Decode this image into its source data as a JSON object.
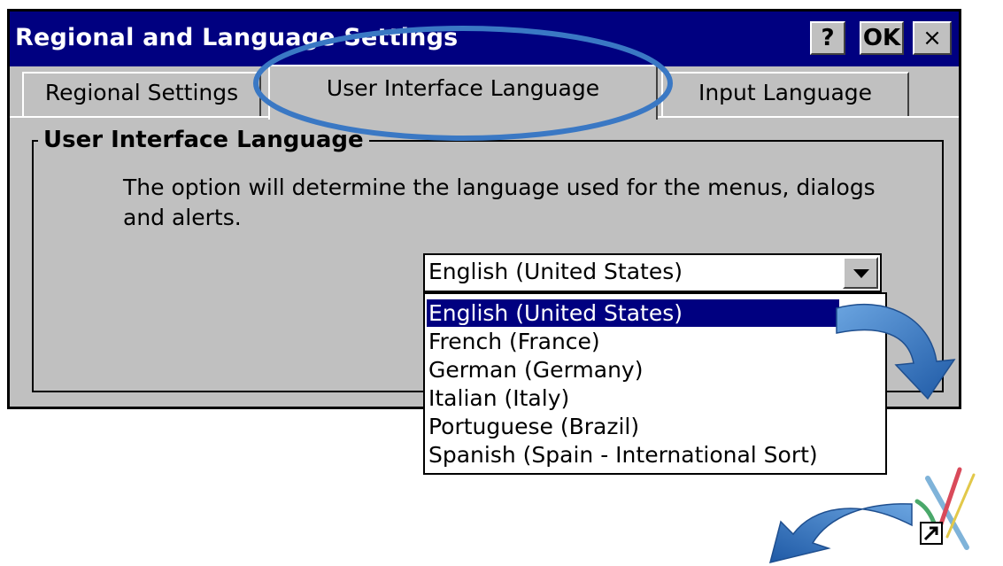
{
  "window": {
    "title": "Regional and Language Settings",
    "help_label": "?",
    "ok_label": "OK",
    "close_label": "×"
  },
  "tabs": [
    {
      "label": "Regional Settings",
      "active": false
    },
    {
      "label": "User Interface Language",
      "active": true
    },
    {
      "label": "Input Language",
      "active": false
    }
  ],
  "group": {
    "title": "User Interface Language",
    "description": "The option will determine the language used for the menus, dialogs and alerts."
  },
  "language_select": {
    "selected": "English (United States)",
    "options": [
      "English (United States)",
      "French (France)",
      "German (Germany)",
      "Italian (Italy)",
      "Portuguese (Brazil)",
      "Spanish (Spain - International Sort)"
    ],
    "highlighted_index": 0
  },
  "icons": {
    "dropdown_arrow": "chevron-down-icon",
    "callout_arrow": "curved-arrow-icon",
    "app_icon": "shortcut-app-icon",
    "highlight": "ellipse-highlight"
  },
  "colors": {
    "titlebar": "#000080",
    "window_bg": "#c0c0c0",
    "highlight_ellipse": "#3a78c4",
    "callout_arrow": "#2e6fba",
    "selection": "#000080"
  }
}
